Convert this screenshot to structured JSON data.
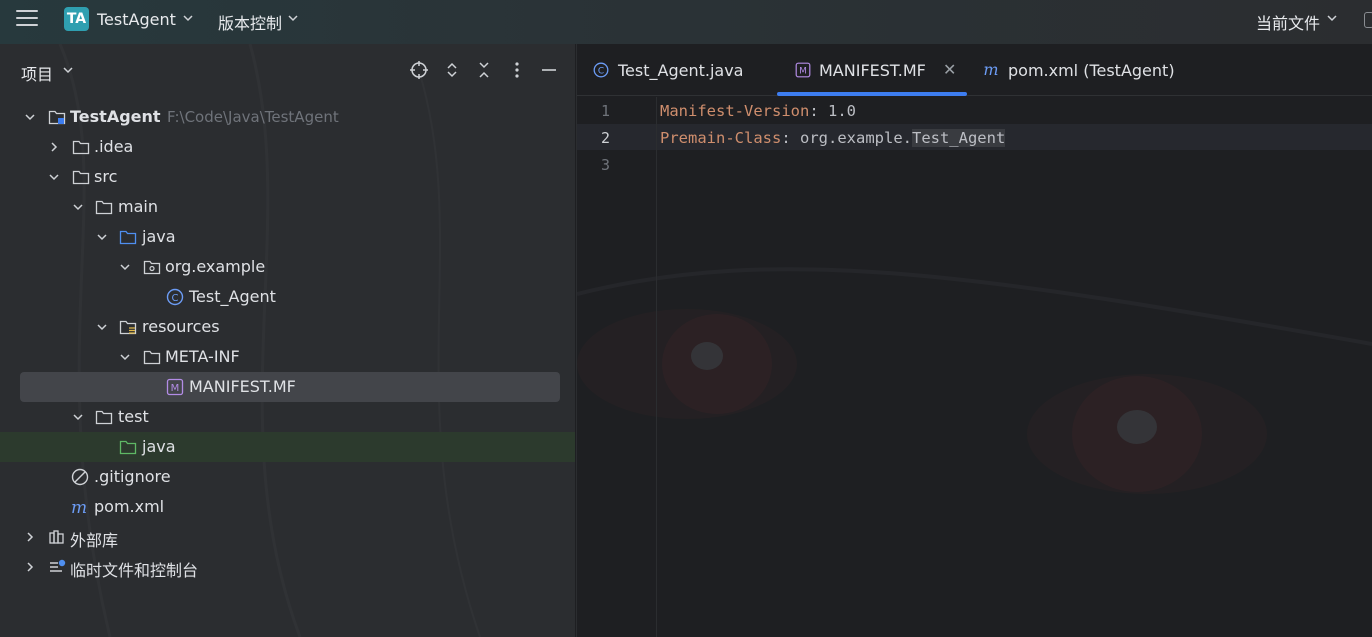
{
  "titlebar": {
    "project_badge": "TA",
    "project_name": "TestAgent",
    "vcs_label": "版本控制",
    "current_file_label": "当前文件"
  },
  "panel": {
    "title": "项目"
  },
  "tree": [
    {
      "label": "TestAgent",
      "hint": "F:\\Code\\Java\\TestAgent",
      "icon": "module-folder-icon"
    },
    {
      "label": ".idea",
      "icon": "folder-icon"
    },
    {
      "label": "src",
      "icon": "folder-icon"
    },
    {
      "label": "main",
      "icon": "folder-icon"
    },
    {
      "label": "java",
      "icon": "source-folder-icon"
    },
    {
      "label": "org.example",
      "icon": "package-icon"
    },
    {
      "label": "Test_Agent",
      "icon": "java-class-icon"
    },
    {
      "label": "resources",
      "icon": "resources-folder-icon"
    },
    {
      "label": "META-INF",
      "icon": "folder-icon"
    },
    {
      "label": "MANIFEST.MF",
      "icon": "manifest-file-icon"
    },
    {
      "label": "test",
      "icon": "folder-icon"
    },
    {
      "label": "java",
      "icon": "test-source-folder-icon"
    },
    {
      "label": ".gitignore",
      "icon": "ignore-file-icon"
    },
    {
      "label": "pom.xml",
      "icon": "maven-icon"
    },
    {
      "label": "外部库",
      "icon": "library-icon"
    },
    {
      "label": "临时文件和控制台",
      "icon": "scratches-icon"
    }
  ],
  "editor": {
    "tabs": [
      {
        "label": "Test_Agent.java",
        "icon": "java-class-icon"
      },
      {
        "label": "MANIFEST.MF",
        "icon": "manifest-file-icon",
        "active": true
      },
      {
        "label": "pom.xml (TestAgent)",
        "icon": "maven-icon"
      }
    ],
    "line_numbers": [
      "1",
      "2",
      "3"
    ],
    "lines": [
      {
        "key": "Manifest-Version",
        "sep": ": ",
        "value": "1.0"
      },
      {
        "key": "Premain-Class",
        "sep": ": ",
        "value_prefix": "org.example.",
        "value_highlight": "Test_Agent"
      }
    ]
  },
  "colors": {
    "accent": "#3d7df0",
    "key_color": "#cf8e6d",
    "badge": "#2f9fb0"
  }
}
